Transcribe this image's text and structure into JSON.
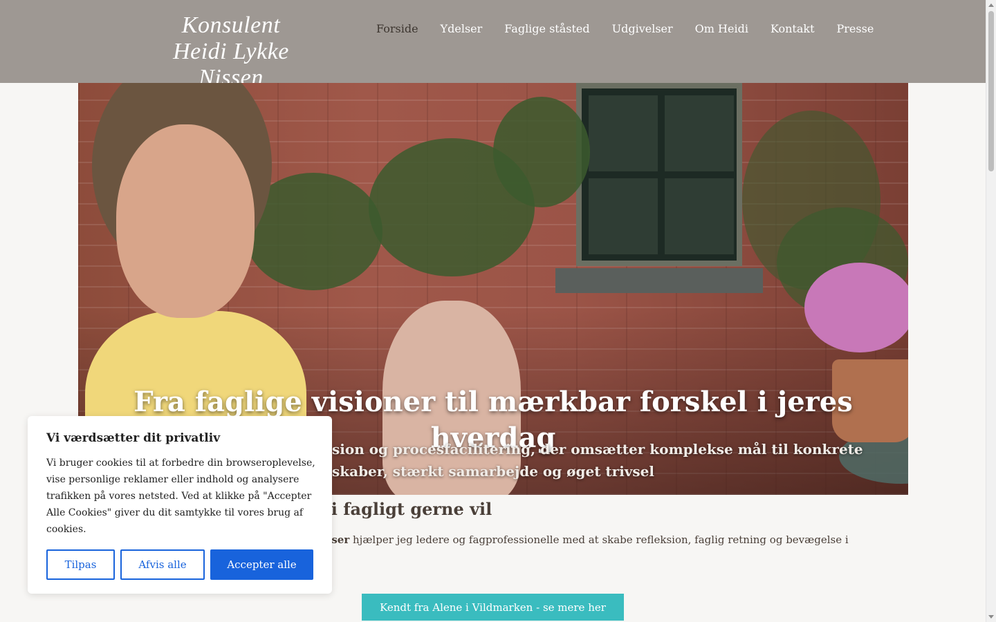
{
  "header": {
    "logo_line1": "Konsulent",
    "logo_line2": "Heidi Lykke Nissen",
    "nav": [
      {
        "label": "Forside",
        "active": true
      },
      {
        "label": "Ydelser"
      },
      {
        "label": "Faglige ståsted"
      },
      {
        "label": "Udgivelser"
      },
      {
        "label": "Om Heidi"
      },
      {
        "label": "Kontakt"
      },
      {
        "label": "Presse"
      }
    ]
  },
  "hero": {
    "title": "Fra faglige visioner til mærkbar forskel i jeres hverdag",
    "subtitle_line1": "sion og procesfacilitering, der omsætter komplekse mål til konkrete",
    "subtitle_line2": "skaber, stærkt samarbejde og øget trivsel"
  },
  "main": {
    "heading": "t, vi fagligt gerne vil",
    "intro_bold": "derviser",
    "intro_rest": " hjælper jeg ledere og fagprofessionelle med at skabe refleksion, faglig retning og bevægelse i en",
    "cta_label": "Kendt fra Alene i Vildmarken - se mere her"
  },
  "cookie_banner": {
    "title": "Vi værdsætter dit privatliv",
    "text": "Vi bruger cookies til at forbedre din browseroplevelse, vise personlige reklamer eller indhold og analysere trafikken på vores netsted. Ved at klikke på \"Accepter Alle Cookies\" giver du dit samtykke til vores brug af cookies.",
    "customize_label": "Tilpas",
    "reject_label": "Afvis alle",
    "accept_label": "Accepter alle"
  },
  "colors": {
    "header_bg": "#9e9893",
    "page_bg": "#f7f6f4",
    "cta_bg": "#3abcbf",
    "cookie_accent": "#1863dc"
  }
}
